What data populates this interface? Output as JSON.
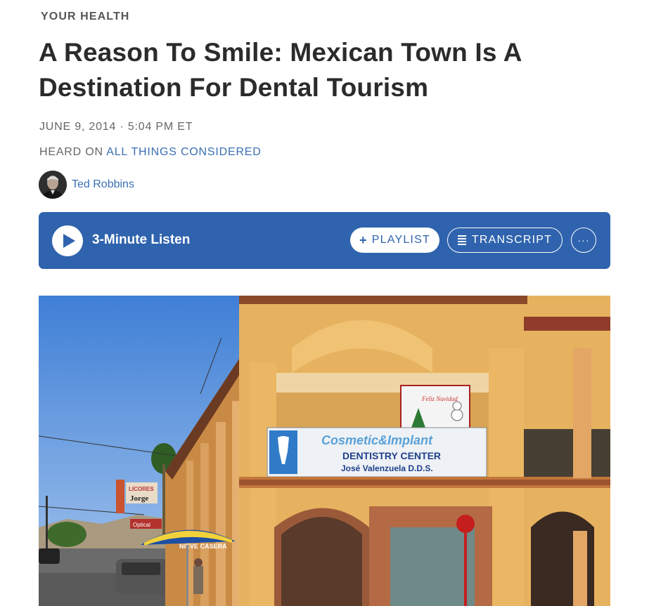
{
  "article": {
    "section": "YOUR HEALTH",
    "title": "A Reason To Smile: Mexican Town Is A Destination For Dental Tourism",
    "dateline": "JUNE 9, 2014 · 5:04 PM ET",
    "heard_on_prefix": "HEARD ON",
    "heard_on_program": "ALL THINGS CONSIDERED",
    "author": "Ted Robbins"
  },
  "player": {
    "listen_label": "3-Minute Listen",
    "playlist_label": "PLAYLIST",
    "transcript_label": "TRANSCRIPT",
    "more_label": "···"
  },
  "photo": {
    "sign_line1": "Cosmetic&Implant",
    "sign_line2": "DENTISTRY CENTER",
    "sign_line3": "José Valenzuela D.D.S.",
    "umbrella_text": "NIEVE CASERA",
    "licores_text": "LICORES",
    "jorge_text": "Jorge",
    "optical_text": "Optical",
    "feliz_text": "Feliz Navidad"
  },
  "colors": {
    "accent": "#2f63ad",
    "link": "#3a6fb3"
  },
  "icons": {
    "play": "play-icon",
    "plus": "plus-icon",
    "transcript": "list-icon",
    "more": "ellipsis-icon"
  }
}
